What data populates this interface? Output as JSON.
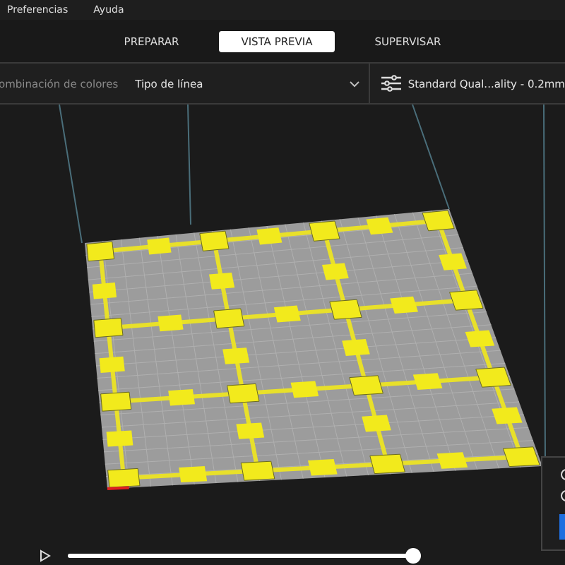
{
  "menu": [
    {
      "label": "Preferencias"
    },
    {
      "label": "Ayuda"
    }
  ],
  "tabs": [
    {
      "label": "PREPARAR",
      "selected": false
    },
    {
      "label": "VISTA PREVIA",
      "selected": true
    },
    {
      "label": "SUPERVISAR",
      "selected": false
    }
  ],
  "color_scheme": {
    "label": "ombinación de colores",
    "value": "Tipo de línea"
  },
  "profile": {
    "label": "Standard Qual...ality - 0.2mm"
  },
  "layer_slider": {
    "level": 1.0
  }
}
